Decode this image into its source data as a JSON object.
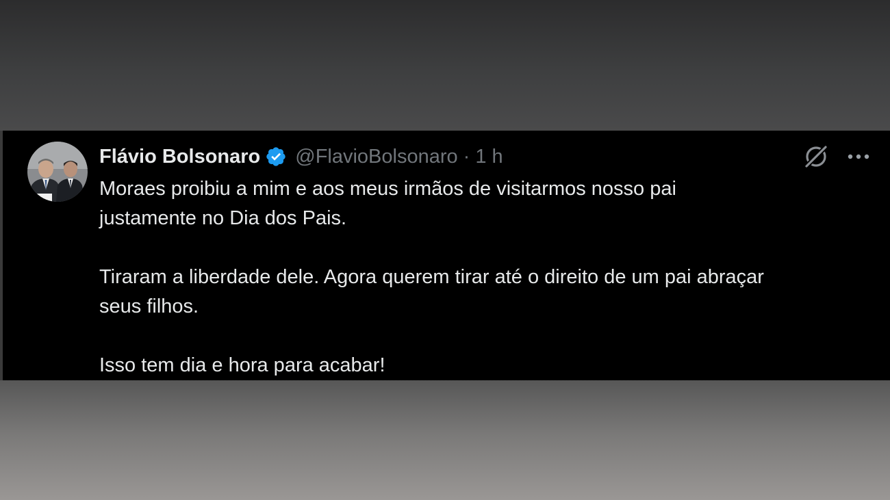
{
  "tweet": {
    "author_name": "Flávio Bolsonaro",
    "handle": "@FlavioBolsonaro",
    "separator": "·",
    "time": "1 h",
    "paragraphs": [
      "Moraes proibiu a mim e aos meus irmãos de visitarmos nosso pai\njustamente no Dia dos Pais.",
      "Tiraram a liberdade dele. Agora querem tirar até o direito de um pai abraçar\nseus filhos.",
      "Isso tem dia e hora para acabar!"
    ]
  },
  "icons": {
    "verified": "verified-badge-icon",
    "grok": "grok-icon",
    "more": "more-options-icon"
  },
  "colors": {
    "tweet_background": "#000000",
    "text_primary": "#e7e9ea",
    "text_secondary": "#71767b",
    "verified_blue": "#1d9bf0"
  }
}
